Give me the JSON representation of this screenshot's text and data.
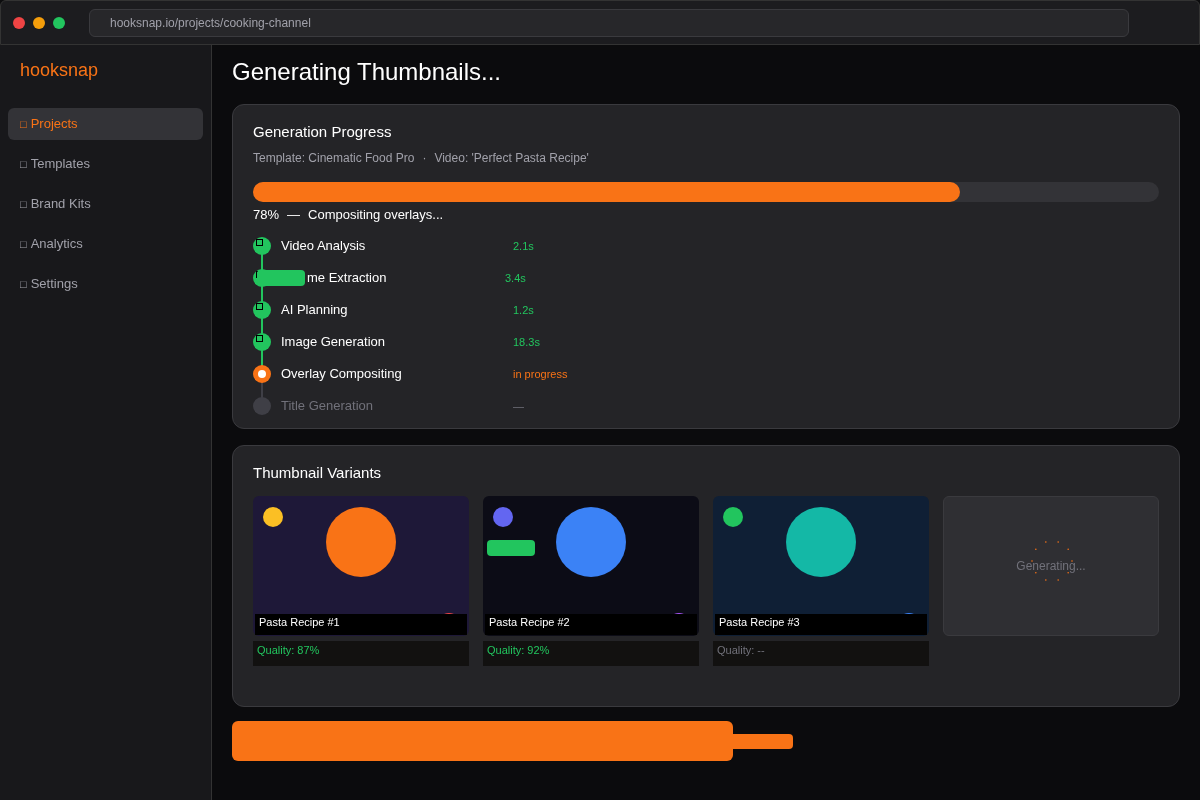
{
  "browser": {
    "url": "hooksnap.io/projects/cooking-channel"
  },
  "sidebar": {
    "logo": "hooksnap",
    "items": [
      {
        "icon": "□",
        "label": "Projects",
        "selected": true
      },
      {
        "icon": "□",
        "label": "Templates",
        "selected": false
      },
      {
        "icon": "□",
        "label": "Brand Kits",
        "selected": false
      },
      {
        "icon": "□",
        "label": "Analytics",
        "selected": false
      },
      {
        "icon": "□",
        "label": "Settings",
        "selected": false
      }
    ]
  },
  "page_title": "Generating Thumbnails...",
  "progress": {
    "title": "Generation Progress",
    "template": "Template: Cinematic Food Pro",
    "separator": "·",
    "video": "Video: 'Perfect Pasta Recipe'",
    "level": 0.78,
    "percent": "78%",
    "dash": "—",
    "message": "Compositing overlays...",
    "steps": [
      {
        "kind": "done",
        "label": "Video Analysis",
        "time": "2.1s"
      },
      {
        "kind": "done",
        "label": "me Extraction",
        "time": "3.4s",
        "blotted": true
      },
      {
        "kind": "done",
        "label": "AI Planning",
        "time": "1.2s"
      },
      {
        "kind": "done",
        "label": "Image Generation",
        "time": "18.3s"
      },
      {
        "kind": "active",
        "label": "Overlay Compositing",
        "time": "in progress"
      },
      {
        "kind": "pending",
        "label": "Title Generation",
        "time": "—"
      }
    ]
  },
  "variants": {
    "title": "Thumbnail Variants",
    "items": [
      {
        "kind": "ready",
        "caption": "Pasta Recipe #1",
        "quality": "Quality: 87%",
        "rated": true
      },
      {
        "kind": "ready",
        "caption": "Pasta Recipe #2",
        "quality": "Quality: 92%",
        "rated": true
      },
      {
        "kind": "ready",
        "caption": "Pasta Recipe #3",
        "quality": "Quality: --",
        "rated": false
      },
      {
        "kind": "generating",
        "caption": "Generating..."
      }
    ]
  }
}
